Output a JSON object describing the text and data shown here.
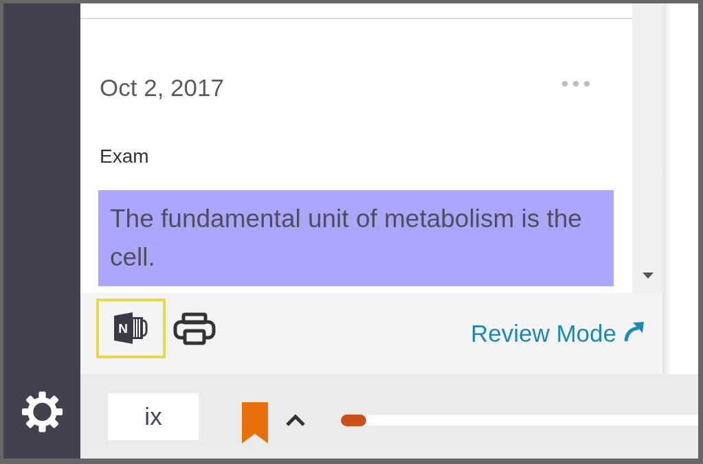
{
  "note": {
    "date": "Oct 2, 2017",
    "label": "Exam",
    "highlight": {
      "text": "The fundamental unit of metabolism is the cell.",
      "color": "#aba6fe"
    }
  },
  "toolbar": {
    "tools": [
      {
        "kind": "onenote",
        "letter": "N",
        "selected": true
      },
      {
        "kind": "print",
        "selected": false
      }
    ],
    "review_link": "Review Mode"
  },
  "footer": {
    "page": "ix",
    "bookmarked": true,
    "slider": {
      "level": 0
    }
  }
}
